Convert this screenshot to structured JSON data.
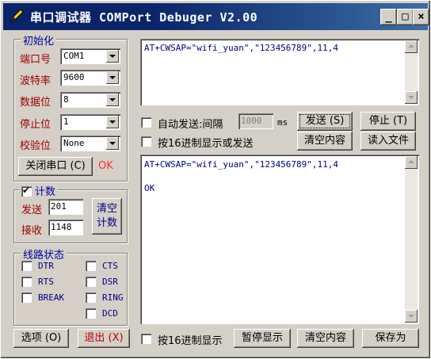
{
  "window": {
    "title": "串口调试器 COMPort Debuger V2.00",
    "minimize_label": "_",
    "maximize_label": "□",
    "close_label": "×"
  },
  "init_group": {
    "title": "初始化",
    "port_label": "端口号",
    "port_value": "COM1",
    "baud_label": "波特率",
    "baud_value": "9600",
    "databits_label": "数据位",
    "databits_value": "8",
    "stopbits_label": "停止位",
    "stopbits_value": "1",
    "parity_label": "校验位",
    "parity_value": "None",
    "close_port_button": "关闭串口 (C)",
    "status": "OK"
  },
  "count_group": {
    "title": "计数",
    "checked": true,
    "send_label": "发送",
    "send_value": "201",
    "recv_label": "接收",
    "recv_value": "1148",
    "clear_button": "清空\n计数"
  },
  "line_status": {
    "title": "线路状态",
    "signals": [
      "DTR",
      "CTS",
      "RTS",
      "DSR",
      "BREAK",
      "RING",
      "DCD"
    ]
  },
  "send_area": {
    "text": "AT+CWSAP=\"wifi_yuan\",\"123456789\",11,4"
  },
  "send_controls": {
    "auto_send_label": "自动发送:间隔",
    "interval_value": "1000",
    "interval_unit": "ms",
    "send_button": "发送 (S)",
    "stop_button": "停止 (T)",
    "hex_send_label": "按16进制显示或发送",
    "clear_content_button": "清空内容",
    "load_file_button": "读入文件"
  },
  "recv_area": {
    "lines": "AT+CWSAP=\"wifi_yuan\",\"123456789\",11,4\n\nOK"
  },
  "bottom": {
    "options_button": "选项 (O)",
    "exit_button": "退出 (X)",
    "hex_display_label": "按16进制显示",
    "pause_button": "暂停显示",
    "clear_button": "清空内容",
    "save_button": "保存为"
  }
}
